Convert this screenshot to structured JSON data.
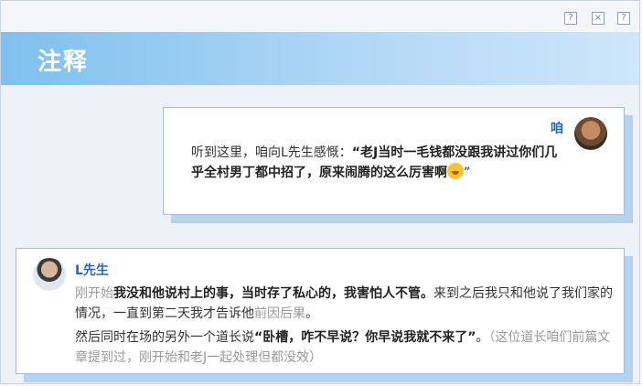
{
  "window": {
    "title": "注释"
  },
  "controls": [
    "?",
    "×",
    "?"
  ],
  "comments": [
    {
      "author": "咱",
      "segments": [
        {
          "text": "听到这里，咱向L先生感慨：",
          "style": "normal"
        },
        {
          "text": "“老J当时一毛钱都没跟我讲过你们几乎全村男丁都中招了，原来闹腾的这么厉害啊",
          "style": "bold"
        },
        {
          "text": "”",
          "style": "normal"
        }
      ]
    },
    {
      "author": "L先生",
      "para1": [
        {
          "text": "刚开始",
          "style": "muted"
        },
        {
          "text": "我没和他说村上的事，当时存了私心的，我害怕人不管。",
          "style": "bold"
        },
        {
          "text": "来到之后我只和他说了我们家的情况，一直到第二天我才告诉他",
          "style": "normal"
        },
        {
          "text": "前因后果",
          "style": "muted"
        },
        {
          "text": "。",
          "style": "normal"
        }
      ],
      "para2": [
        {
          "text": "然后同时在场的另外一个道长说",
          "style": "normal"
        },
        {
          "text": "“卧槽，咋不早说？你早说我就不来了”",
          "style": "bold"
        },
        {
          "text": "。",
          "style": "normal"
        },
        {
          "text": "（这位道长咱们前篇文章提到过，刚开始和老J一起处理但都没效）",
          "style": "muted"
        }
      ]
    }
  ]
}
